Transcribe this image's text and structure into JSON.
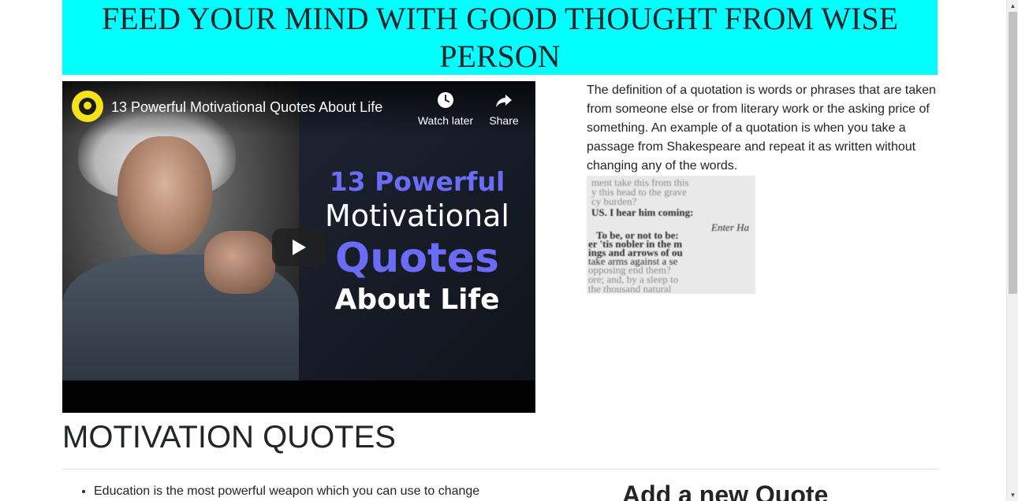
{
  "header": {
    "title": "FEED YOUR MIND WITH GOOD THOUGHT FROM WISE PERSON"
  },
  "video": {
    "title": "13 Powerful Motivational Quotes About Life",
    "watch_later_label": "Watch later",
    "share_label": "Share",
    "thumbnail_text": {
      "line1": "13 Powerful",
      "line2": "Motivational",
      "line3": "Quotes",
      "line4": "About Life"
    },
    "icons": [
      "channel-avatar",
      "clock-icon",
      "share-icon",
      "play-icon"
    ]
  },
  "intro": {
    "text": "The definition of a quotation is words or phrases that are taken from someone else or from literary work or the asking price of something. An example of a quotation is when you take a passage from Shakespeare and repeat it as written without changing any of the words."
  },
  "quote_image": {
    "lines": [
      "ment take this from this",
      "y this head to the grave",
      "cy burden?",
      "US. I hear him coming:",
      "Enter Ha",
      "To be, or not to be:",
      "er 'tis nobler in the m",
      "ings and arrows of ou",
      "take arms against a se",
      "opposing end them?",
      "ore; and, by a sleep to",
      "the thousand natural"
    ]
  },
  "main": {
    "section_title": "MOTIVATION QUOTES",
    "quotes": [
      "Education is the most powerful weapon which you can use to change"
    ],
    "add_quote_title": "Add a new Quote"
  },
  "colors": {
    "banner": "#00ffff",
    "text": "#212529",
    "accent_purple": "#6a6cf5"
  }
}
